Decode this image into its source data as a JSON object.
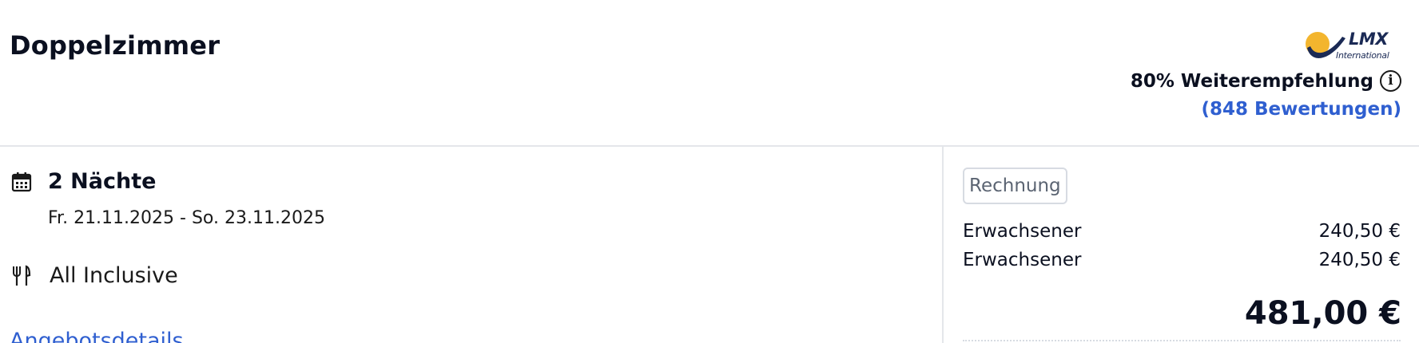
{
  "room": {
    "title": "Doppelzimmer"
  },
  "rating": {
    "brand_text_main": "LMX",
    "brand_text_sub": "International",
    "recommendation": "80% Weiterempfehlung",
    "reviews": "(848 Bewertungen)",
    "icon": "info-icon"
  },
  "stay": {
    "nights": "2 Nächte",
    "dates": "Fr. 21.11.2025 - So. 23.11.2025",
    "nights_icon": "calendar-icon",
    "board": "All Inclusive",
    "board_icon": "cutlery-icon"
  },
  "offer_details_link": "Angebotsdetails",
  "invoice": {
    "badge": "Rechnung",
    "items": [
      {
        "label": "Erwachsener",
        "price": "240,50 €"
      },
      {
        "label": "Erwachsener",
        "price": "240,50 €"
      }
    ],
    "total": "481,00 €"
  },
  "colors": {
    "link": "#2f5fd0",
    "logo_sun": "#f3b52e",
    "logo_text": "#1b2a55",
    "divider": "#e4e6ea"
  }
}
